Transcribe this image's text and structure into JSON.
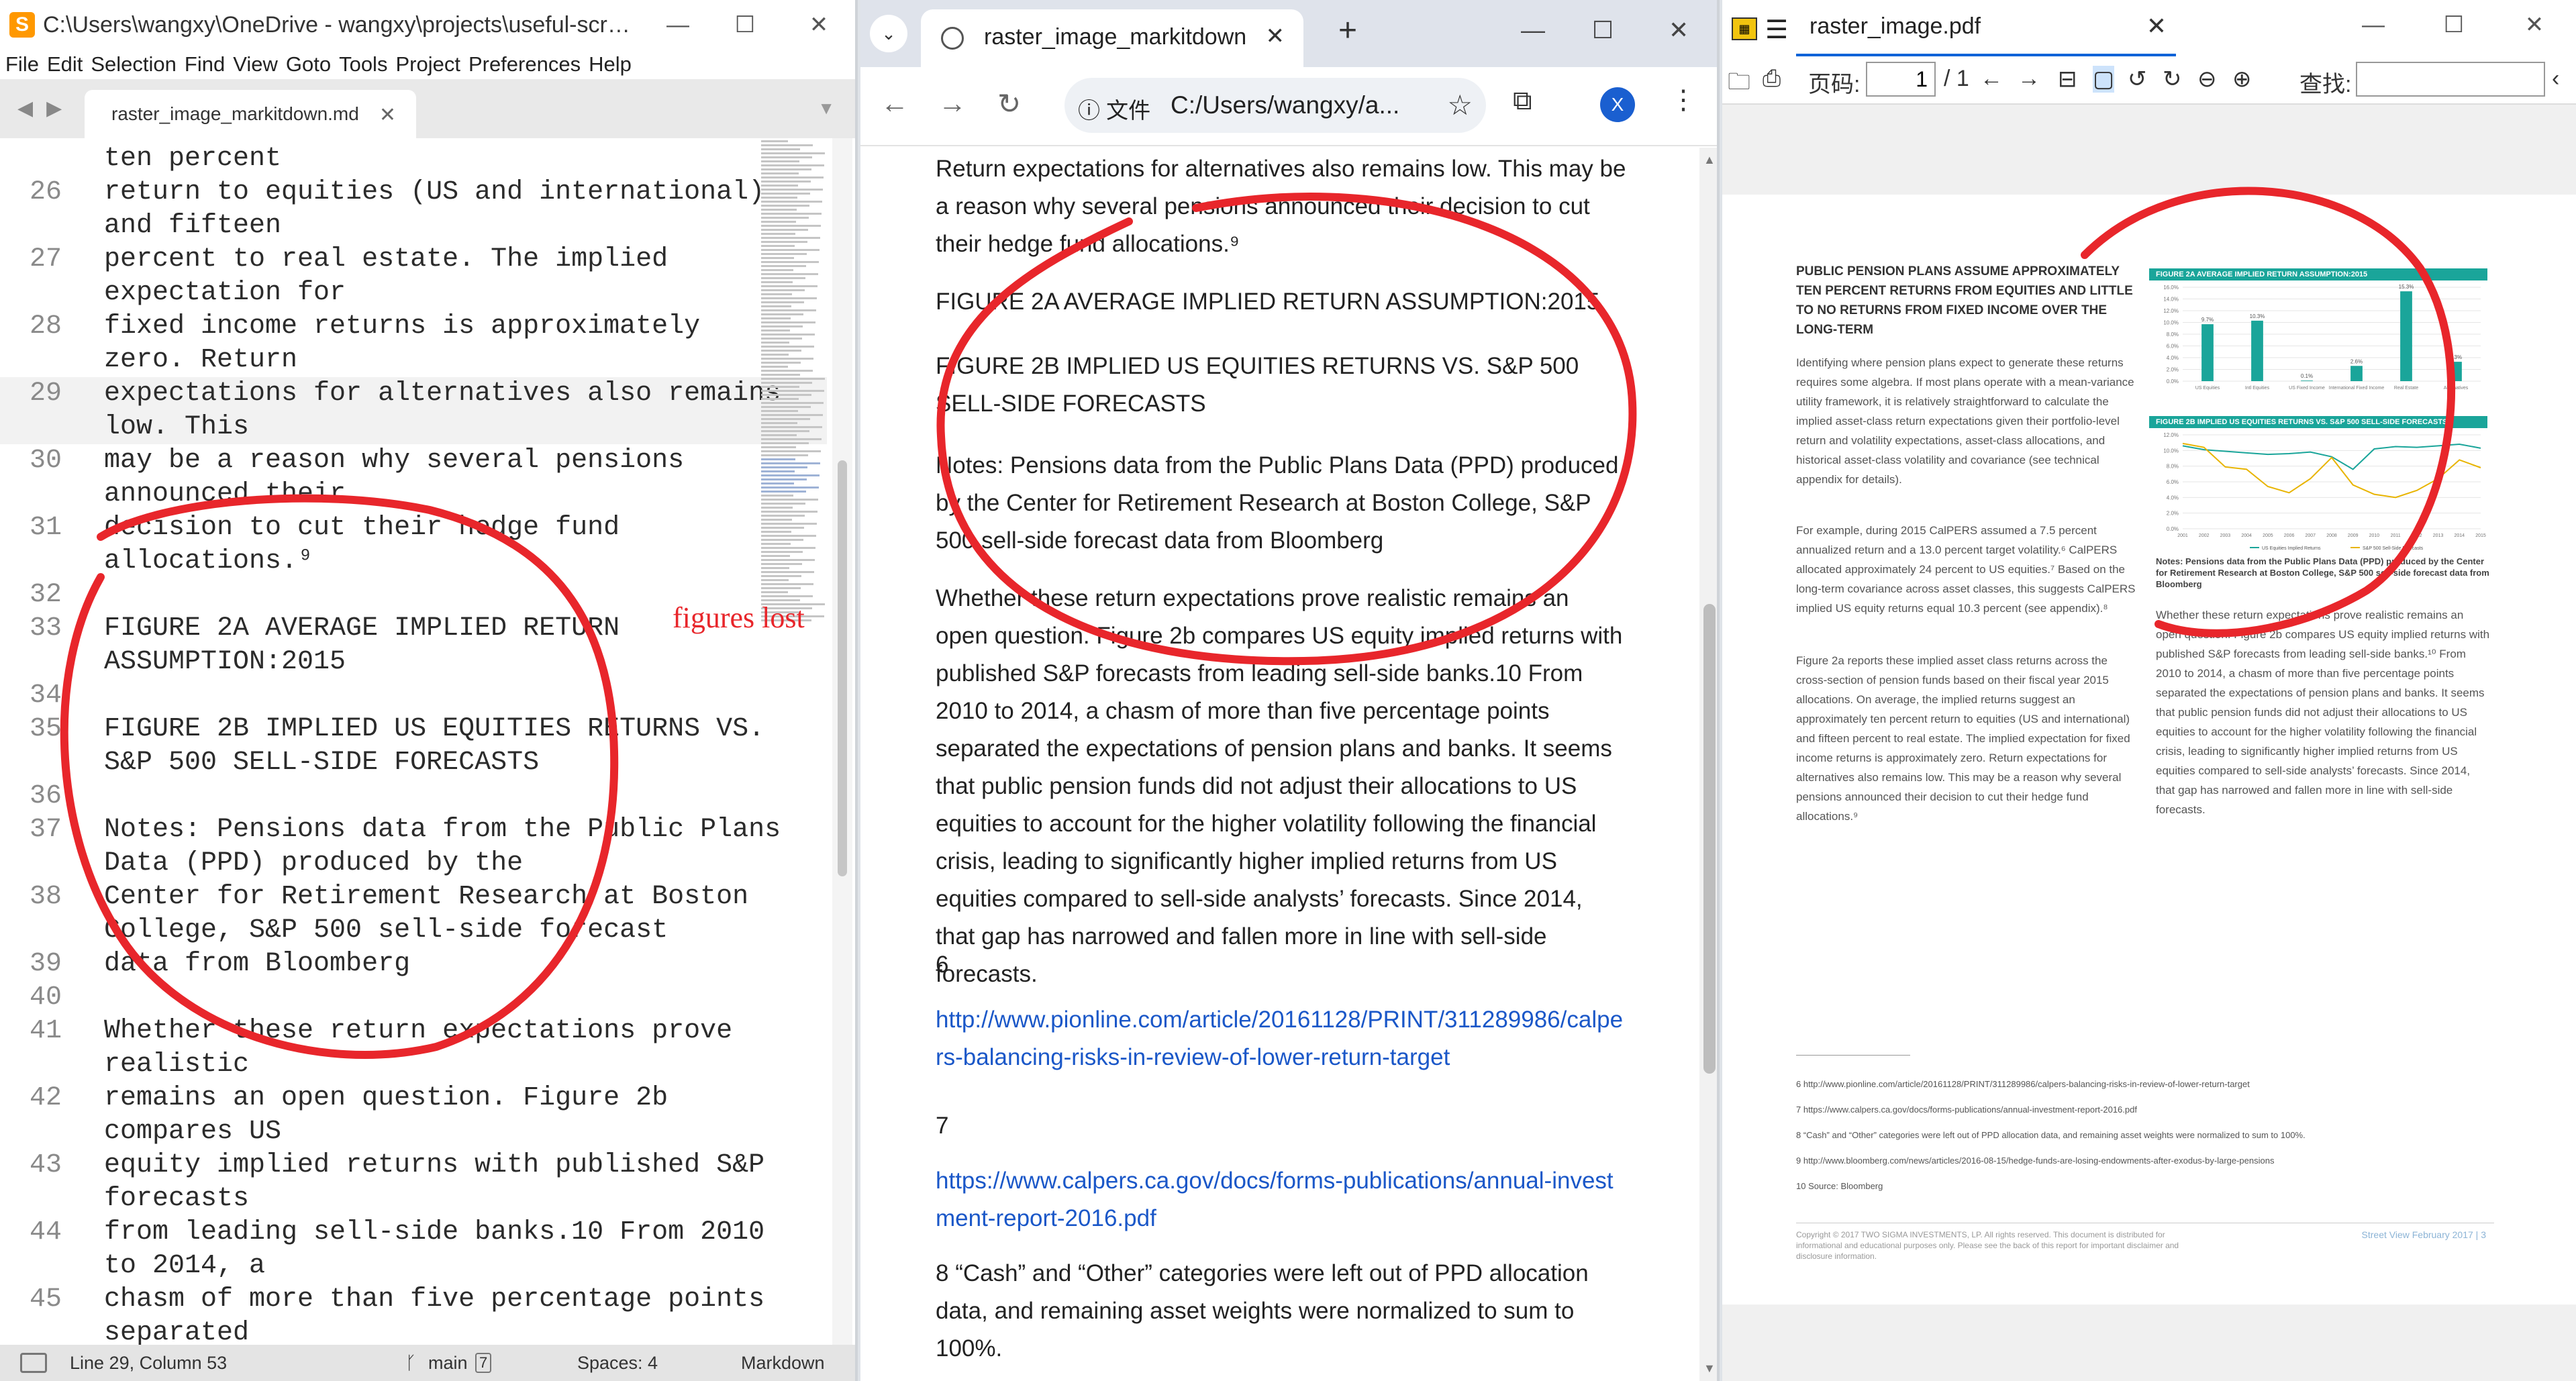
{
  "editor": {
    "app_icon": "S",
    "title": "C:\\Users\\wangxy\\OneDrive - wangxy\\projects\\useful-script...",
    "menu": [
      "File",
      "Edit",
      "Selection",
      "Find",
      "View",
      "Goto",
      "Tools",
      "Project",
      "Preferences",
      "Help"
    ],
    "tab_label": "raster_image_markitdown.md",
    "lines": [
      {
        "num": "",
        "text": "ten percent"
      },
      {
        "num": "26",
        "text": "return to equities (US and international)"
      },
      {
        "num": "",
        "text": "and fifteen"
      },
      {
        "num": "27",
        "text": "percent to real estate. The implied"
      },
      {
        "num": "",
        "text": "expectation for"
      },
      {
        "num": "28",
        "text": "fixed income returns is approximately"
      },
      {
        "num": "",
        "text": "zero. Return"
      },
      {
        "num": "29",
        "text": "expectations for alternatives also remains"
      },
      {
        "num": "",
        "text": "low. This"
      },
      {
        "num": "30",
        "text": "may be a reason why several pensions"
      },
      {
        "num": "",
        "text": "announced their"
      },
      {
        "num": "31",
        "text": "decision to cut their hedge fund"
      },
      {
        "num": "",
        "text": "allocations.⁹"
      },
      {
        "num": "32",
        "text": ""
      },
      {
        "num": "33",
        "text": "FIGURE 2A AVERAGE IMPLIED RETURN"
      },
      {
        "num": "",
        "text": "ASSUMPTION:2015"
      },
      {
        "num": "34",
        "text": ""
      },
      {
        "num": "35",
        "text": "FIGURE 2B IMPLIED US EQUITIES RETURNS VS."
      },
      {
        "num": "",
        "text": "S&P 500 SELL-SIDE FORECASTS"
      },
      {
        "num": "36",
        "text": ""
      },
      {
        "num": "37",
        "text": "Notes: Pensions data from the Public Plans"
      },
      {
        "num": "",
        "text": "Data (PPD) produced by the"
      },
      {
        "num": "38",
        "text": "Center for Retirement Research at Boston"
      },
      {
        "num": "",
        "text": "College, S&P 500 sell-side forecast"
      },
      {
        "num": "39",
        "text": "data from Bloomberg"
      },
      {
        "num": "40",
        "text": ""
      },
      {
        "num": "41",
        "text": "Whether these return expectations prove"
      },
      {
        "num": "",
        "text": "realistic"
      },
      {
        "num": "42",
        "text": "remains an open question. Figure 2b"
      },
      {
        "num": "",
        "text": "compares US"
      },
      {
        "num": "43",
        "text": "equity implied returns with published S&P"
      },
      {
        "num": "",
        "text": "forecasts"
      },
      {
        "num": "44",
        "text": "from leading sell-side banks.10 From 2010"
      },
      {
        "num": "",
        "text": "to 2014, a"
      },
      {
        "num": "45",
        "text": "chasm of more than five percentage points"
      },
      {
        "num": "",
        "text": "separated"
      }
    ],
    "annotation": "figures lost",
    "status": {
      "position": "Line 29, Column 53",
      "branch": "main",
      "branch_count": "7",
      "spaces": "Spaces: 4",
      "syntax": "Markdown"
    }
  },
  "browser": {
    "tab_label": "raster_image_markitdown",
    "info_label": "文件",
    "url": "C:/Users/wangxy/a...",
    "profile_initial": "X",
    "paragraphs": [
      "Return expectations for alternatives also remains low. This may be a reason why several pensions announced their decision to cut their hedge fund allocations.⁹",
      "FIGURE 2A AVERAGE IMPLIED RETURN ASSUMPTION:2015",
      "FIGURE 2B IMPLIED US EQUITIES RETURNS VS. S&P 500 SELL-SIDE FORECASTS",
      "Notes: Pensions data from the Public Plans Data (PPD) produced by the Center for Retirement Research at Boston College, S&P 500 sell-side forecast data from Bloomberg",
      "Whether these return expectations prove realistic remains an open question. Figure 2b compares US equity implied returns with published S&P forecasts from leading sell-side banks.10 From 2010 to 2014, a chasm of more than five percentage points separated the expectations of pension plans and banks. It seems that public pension funds did not adjust their allocations to US equities to account for the higher volatility following the financial crisis, leading to significantly higher implied returns from US equities compared to sell-side analysts’ forecasts. Since 2014, that gap has narrowed and fallen more in line with sell-side forecasts.",
      "6",
      "http://www.pionline.com/article/20161128/PRINT/311289986/calpers-balancing-risks-in-review-of-lower-return-target",
      "7",
      "https://www.calpers.ca.gov/docs/forms-publications/annual-investment-report-2016.pdf",
      "8 “Cash” and “Other” categories were left out of PPD allocation data, and remaining asset weights were normalized to sum to 100%."
    ]
  },
  "pdf": {
    "tab_label": "raster_image.pdf",
    "page_label": "页码:",
    "page_value": "1",
    "page_total": "/ 1",
    "find_label": "查找:",
    "heading": "PUBLIC PENSION PLANS ASSUME APPROXIMATELY TEN PERCENT RETURNS FROM EQUITIES AND LITTLE TO NO RETURNS FROM FIXED INCOME OVER THE LONG-TERM",
    "col1": [
      "Identifying where pension plans expect to generate these returns requires some algebra. If most plans operate with a mean-variance utility framework, it is relatively straightforward to calculate the implied asset-class return expectations given their portfolio-level return and volatility expectations, asset-class allocations, and historical asset-class volatility and covariance (see technical appendix for details).",
      "For example, during 2015 CalPERS assumed a 7.5 percent annualized return and a 13.0 percent target volatility.⁶ CalPERS allocated approximately 24 percent to US equities.⁷ Based on the long-term covariance across asset classes, this suggests CalPERS implied US equity returns equal 10.3 percent (see appendix).⁸",
      "Figure 2a reports these implied asset class returns across the cross-section of pension funds based on their fiscal year 2015 allocations. On average, the implied returns suggest an approximately ten percent return to equities (US and international) and fifteen percent to real estate. The implied expectation for fixed income returns is approximately zero. Return expectations for alternatives also remains low. This may be a reason why several pensions announced their decision to cut their hedge fund allocations.⁹"
    ],
    "fig2a_title": "FIGURE 2A AVERAGE IMPLIED RETURN ASSUMPTION:2015",
    "fig2b_title": "FIGURE 2B IMPLIED US EQUITIES RETURNS VS. S&P 500 SELL-SIDE FORECASTS",
    "notes": "Notes: Pensions data from the Public Plans Data (PPD) produced by the Center for Retirement Research at Boston College, S&P 500 sell-side forecast data from Bloomberg",
    "col2": "Whether these return expectations prove realistic remains an open question. Figure 2b compares US equity implied returns with published S&P forecasts from leading sell-side banks.¹⁰ From 2010 to 2014, a chasm of more than five percentage points separated the expectations of pension plans and banks. It seems that public pension funds did not adjust their allocations to US equities to account for the higher volatility following the financial crisis, leading to significantly higher implied returns from US equities compared to sell-side analysts’ forecasts. Since 2014, that gap has narrowed and fallen more in line with sell-side forecasts.",
    "footnotes": [
      "6 http://www.pionline.com/article/20161128/PRINT/311289986/calpers-balancing-risks-in-review-of-lower-return-target",
      "7 https://www.calpers.ca.gov/docs/forms-publications/annual-investment-report-2016.pdf",
      "8 “Cash” and “Other” categories were left out of PPD allocation data, and remaining asset weights were normalized to sum to 100%.",
      "9 http://www.bloomberg.com/news/articles/2016-08-15/hedge-funds-are-losing-endowments-after-exodus-by-large-pensions",
      "10 Source: Bloomberg"
    ],
    "copyright": "Copyright © 2017 TWO SIGMA INVESTMENTS, LP. All rights reserved. This document is distributed for informational and educational purposes only. Please see the back of this report for important disclaimer and disclosure information.",
    "footer": "Street View February 2017 | 3"
  },
  "chart_data": [
    {
      "type": "bar",
      "title": "FIGURE 2A AVERAGE IMPLIED RETURN ASSUMPTION:2015",
      "categories": [
        "US Equities",
        "Intl Equities",
        "US Fixed Income",
        "International Fixed Income",
        "Real Estate",
        "Alternatives"
      ],
      "values": [
        9.7,
        10.3,
        0.1,
        2.6,
        15.3,
        3.3
      ],
      "data_labels": [
        "9.7%",
        "10.3%",
        "0.1%",
        "2.6%",
        "15.3%",
        "3.3%"
      ],
      "ylim": [
        0,
        16
      ]
    },
    {
      "type": "line",
      "title": "FIGURE 2B IMPLIED US EQUITIES RETURNS VS. S&P 500 SELL-SIDE FORECASTS",
      "x": [
        "2001",
        "2002",
        "2003",
        "2004",
        "2005",
        "2006",
        "2007",
        "2008",
        "2009",
        "2010",
        "2011",
        "2012",
        "2013",
        "2014",
        "2015"
      ],
      "series": [
        {
          "name": "US Equities Implied Returns",
          "values": [
            10.6,
            10.1,
            9.9,
            9.7,
            9.5,
            9.6,
            9.8,
            9.2,
            7.6,
            10.2,
            10.5,
            10.4,
            10.6,
            10.8,
            10.3
          ]
        },
        {
          "name": "S&P 500 Sell-Side Forecasts",
          "values": [
            10.9,
            10.4,
            7.9,
            7.6,
            5.4,
            4.6,
            6.4,
            9.1,
            5.6,
            4.4,
            4.0,
            4.9,
            6.4,
            8.8,
            7.8
          ]
        }
      ],
      "ylim": [
        0,
        12
      ]
    }
  ]
}
